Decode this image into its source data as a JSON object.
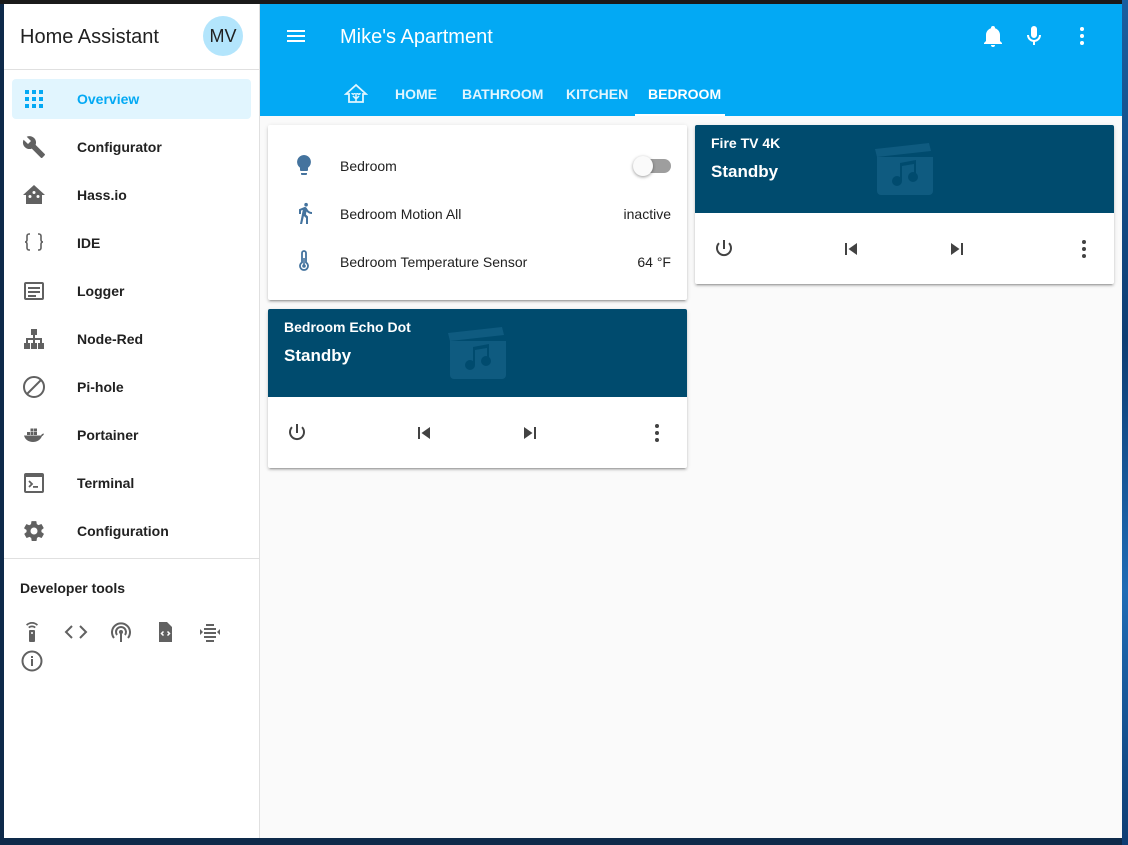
{
  "sidebar": {
    "title": "Home Assistant",
    "avatar_initials": "MV",
    "items": [
      {
        "label": "Overview"
      },
      {
        "label": "Configurator"
      },
      {
        "label": "Hass.io"
      },
      {
        "label": "IDE"
      },
      {
        "label": "Logger"
      },
      {
        "label": "Node-Red"
      },
      {
        "label": "Pi-hole"
      },
      {
        "label": "Portainer"
      },
      {
        "label": "Terminal"
      },
      {
        "label": "Configuration"
      }
    ],
    "developer_tools_title": "Developer tools"
  },
  "header": {
    "title": "Mike's Apartment",
    "tabs": [
      {
        "label": "HOME"
      },
      {
        "label": "BATHROOM"
      },
      {
        "label": "KITCHEN"
      },
      {
        "label": "BEDROOM"
      }
    ]
  },
  "entities_card": {
    "rows": [
      {
        "name": "Bedroom",
        "icon": "lightbulb-icon"
      },
      {
        "name": "Bedroom Motion All",
        "value": "inactive",
        "icon": "walk-icon"
      },
      {
        "name": "Bedroom Temperature Sensor",
        "value": "64 °F",
        "icon": "thermometer-icon"
      }
    ],
    "toggle_state": "off"
  },
  "media_cards": [
    {
      "name": "Fire TV 4K",
      "state": "Standby"
    },
    {
      "name": "Bedroom Echo Dot",
      "state": "Standby"
    }
  ],
  "colors": {
    "accent": "#03a9f4",
    "media_bg": "#004b6e",
    "active_nav_bg": "#e1f5fe",
    "icon_blue": "#44739e"
  }
}
